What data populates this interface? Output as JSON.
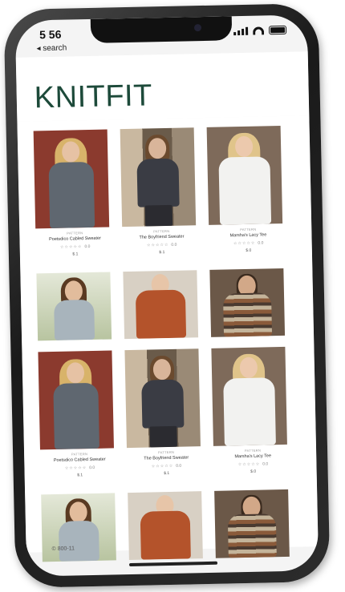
{
  "status_bar": {
    "time": "5 56"
  },
  "nav": {
    "back_label": "◂ search"
  },
  "header": {
    "logo": "KNITFIT"
  },
  "products_row1": [
    {
      "category": "PATTERN",
      "name": "Poetsdico Cabled Sweater",
      "stars": "☆☆☆☆☆",
      "rating": "0.0",
      "price": "$.1"
    },
    {
      "category": "PATTERN",
      "name": "The Boyfriend Sweater",
      "stars": "☆☆☆☆☆",
      "rating": "0.0",
      "price": "$.1"
    },
    {
      "category": "PATTERN",
      "name": "Marsha's Lacy Tee",
      "stars": "☆☆☆☆☆",
      "rating": "0.0",
      "price": "$.0"
    }
  ],
  "products_row3": [
    {
      "category": "PATTERN",
      "name": "Poetsdico Cabled Sweater",
      "stars": "☆☆☆☆☆",
      "rating": "0.0",
      "price": "$.1"
    },
    {
      "category": "PATTERN",
      "name": "The Boyfriend Sweater",
      "stars": "☆☆☆☆☆",
      "rating": "0.0",
      "price": "$.1"
    },
    {
      "category": "PATTERN",
      "name": "Marsha's Lacy Tee",
      "stars": "☆☆☆☆☆",
      "rating": "0.0",
      "price": "$.0"
    }
  ],
  "footer": {
    "link": "© 800-11"
  },
  "colors": {
    "brand": "#1d4a3a",
    "grey_sweater": "#5f6770",
    "rust_sweater": "#b4532b",
    "white_tee": "#f2f2f0",
    "brick": "#8b3a2e"
  }
}
